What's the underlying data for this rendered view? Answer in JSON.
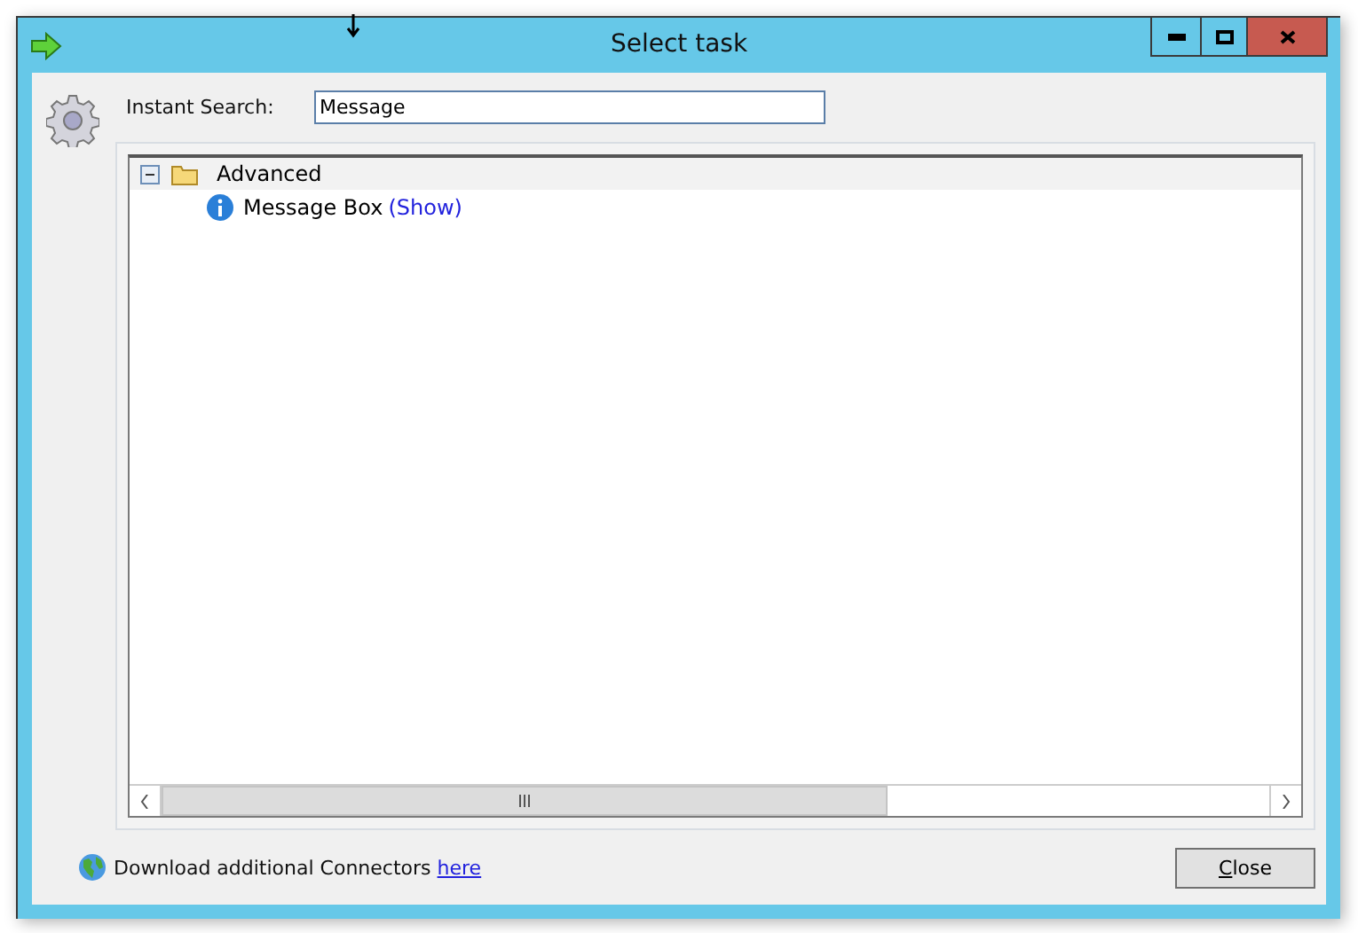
{
  "window": {
    "title": "Select task"
  },
  "search": {
    "label": "Instant Search:",
    "value": "Message"
  },
  "tree": [
    {
      "label": "Advanced",
      "expanded": true,
      "children": [
        {
          "label": "Message Box",
          "link": "(Show)"
        }
      ]
    }
  ],
  "footer": {
    "text": "Download additional Connectors",
    "link": "here"
  },
  "buttons": [
    "Close"
  ]
}
